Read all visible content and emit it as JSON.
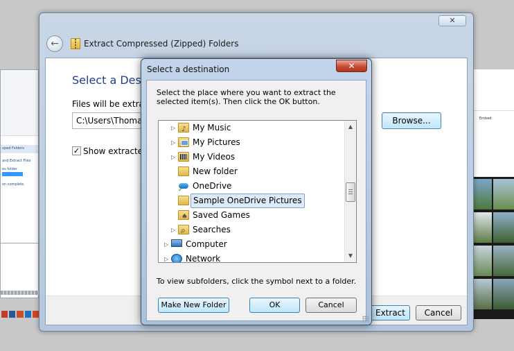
{
  "wizard": {
    "title": "Extract Compressed (Zipped) Folders",
    "close_glyph": "✕",
    "heading": "Select a Destin",
    "files_label": "Files will be extracte",
    "path_value": "C:\\Users\\Thomash",
    "browse_label": "Browse...",
    "show_label": "Show extracted f",
    "extract_label": "Extract",
    "cancel_label": "Cancel"
  },
  "dialog": {
    "title": "Select a destination",
    "close_glyph": "✕",
    "instructions": "Select the place where you want to extract the selected item(s).  Then click the OK button.",
    "tree_items": [
      {
        "label": "My Music",
        "icon": "music-folder-icon",
        "expandable": true
      },
      {
        "label": "My Pictures",
        "icon": "pictures-folder-icon",
        "expandable": true
      },
      {
        "label": "My Videos",
        "icon": "videos-folder-icon",
        "expandable": true
      },
      {
        "label": "New folder",
        "icon": "folder-icon",
        "expandable": false
      },
      {
        "label": "OneDrive",
        "icon": "onedrive-icon",
        "expandable": false
      },
      {
        "label": "Sample OneDrive Pictures",
        "icon": "folder-icon",
        "expandable": false,
        "selected": true
      },
      {
        "label": "Saved Games",
        "icon": "saved-games-icon",
        "expandable": false
      },
      {
        "label": "Searches",
        "icon": "searches-icon",
        "expandable": true
      },
      {
        "label": "Computer",
        "icon": "computer-icon",
        "expandable": true
      },
      {
        "label": "Network",
        "icon": "network-icon",
        "expandable": true
      }
    ],
    "hint": "To view subfolders, click the symbol next to a folder.",
    "make_new_folder_label": "Make New Folder",
    "ok_label": "OK",
    "cancel_label": "Cancel"
  },
  "background": {
    "left_title": "xped Folders",
    "left_item": "and Extract Files",
    "left_sub": "es folder",
    "left_status": "on complete.",
    "right_tab": "Embed"
  }
}
